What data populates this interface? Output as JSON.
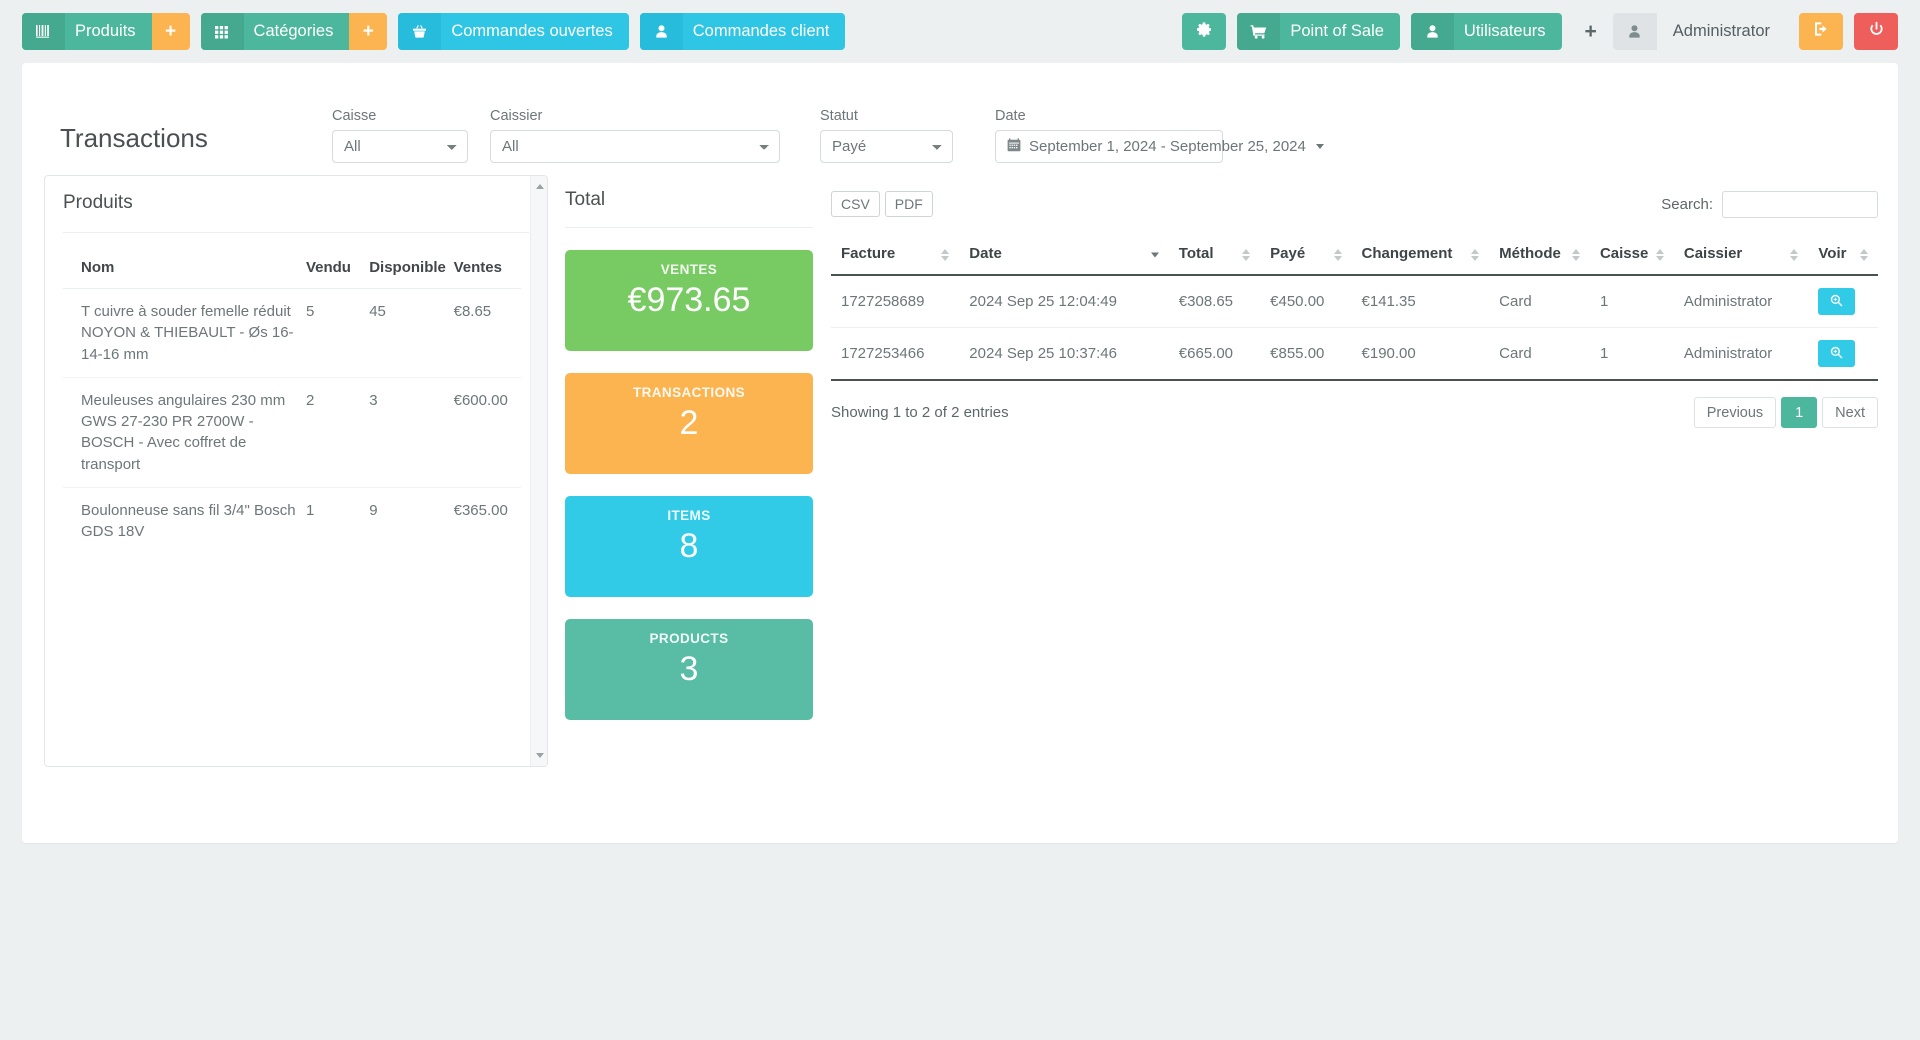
{
  "navbar": {
    "groups": [
      {
        "icon": "barcode-icon",
        "label": "Produits",
        "plus": "+"
      },
      {
        "icon": "grid-icon",
        "label": "Catégories",
        "plus": "+"
      },
      {
        "icon": "basket-icon",
        "label": "Commandes ouvertes",
        "plus": ""
      },
      {
        "icon": "user-icon",
        "label": "Commandes client",
        "plus": ""
      }
    ],
    "settings_icon": "gear-icon",
    "pos": {
      "icon": "cart-icon",
      "label": "Point of Sale"
    },
    "users": {
      "icon": "user-icon",
      "label": "Utilisateurs"
    },
    "add_label": "+",
    "account": {
      "icon": "user-icon",
      "name": "Administrator"
    },
    "logout_icon": "logout-icon",
    "power_icon": "power-icon",
    "colors": {
      "teal": "#4cb79c",
      "orange": "#fbb450",
      "cyan": "#2fc5e4",
      "grey": "#dfe3e6",
      "red": "#ee5f5b"
    }
  },
  "page": {
    "title": "Transactions"
  },
  "filters": {
    "caisse": {
      "label": "Caisse",
      "value": "All",
      "options": [
        "All"
      ]
    },
    "caissier": {
      "label": "Caissier",
      "value": "All",
      "options": [
        "All"
      ]
    },
    "statut": {
      "label": "Statut",
      "value": "Payé",
      "options": [
        "Payé"
      ]
    },
    "date": {
      "label": "Date",
      "value": "September 1, 2024 - September 25, 2024",
      "icon": "calendar-icon"
    }
  },
  "produits": {
    "title": "Produits",
    "columns": [
      "Nom",
      "Vendu",
      "Disponible",
      "Ventes"
    ],
    "rows": [
      {
        "nom": "T cuivre à souder femelle réduit NOYON & THIEBAULT - Øs 16-14-16 mm",
        "vendu": "5",
        "disponible": "45",
        "ventes": "€8.65"
      },
      {
        "nom": "Meuleuses angulaires 230 mm GWS 27-230 PR 2700W - BOSCH - Avec coffret de transport",
        "vendu": "2",
        "disponible": "3",
        "ventes": "€600.00"
      },
      {
        "nom": "Boulonneuse sans fil 3/4\" Bosch GDS 18V",
        "vendu": "1",
        "disponible": "9",
        "ventes": "€365.00"
      }
    ]
  },
  "total": {
    "title": "Total",
    "cards": [
      {
        "label": "VENTES",
        "value": "€973.65",
        "color": "#78cb62"
      },
      {
        "label": "TRANSACTIONS",
        "value": "2",
        "color": "#fbb450"
      },
      {
        "label": "ITEMS",
        "value": "8",
        "color": "#31cbe8"
      },
      {
        "label": "PRODUCTS",
        "value": "3",
        "color": "#58bda4"
      }
    ]
  },
  "transactions": {
    "export_csv": "CSV",
    "export_pdf": "PDF",
    "search_label": "Search:",
    "search_value": "",
    "columns": [
      "Facture",
      "Date",
      "Total",
      "Payé",
      "Changement",
      "Méthode",
      "Caisse",
      "Caissier",
      "Voir"
    ],
    "sorted_column": "Date",
    "sort_direction": "desc",
    "rows": [
      {
        "facture": "1727258689",
        "date": "2024 Sep 25 12:04:49",
        "total": "€308.65",
        "paye": "€450.00",
        "changement": "€141.35",
        "methode": "Card",
        "caisse": "1",
        "caissier": "Administrator",
        "voir_icon": "search-plus-icon"
      },
      {
        "facture": "1727253466",
        "date": "2024 Sep 25 10:37:46",
        "total": "€665.00",
        "paye": "€855.00",
        "changement": "€190.00",
        "methode": "Card",
        "caisse": "1",
        "caissier": "Administrator",
        "voir_icon": "search-plus-icon"
      }
    ],
    "info": "Showing 1 to 2 of 2 entries",
    "pagination": {
      "previous": "Previous",
      "pages": [
        "1"
      ],
      "current": "1",
      "next": "Next"
    }
  }
}
